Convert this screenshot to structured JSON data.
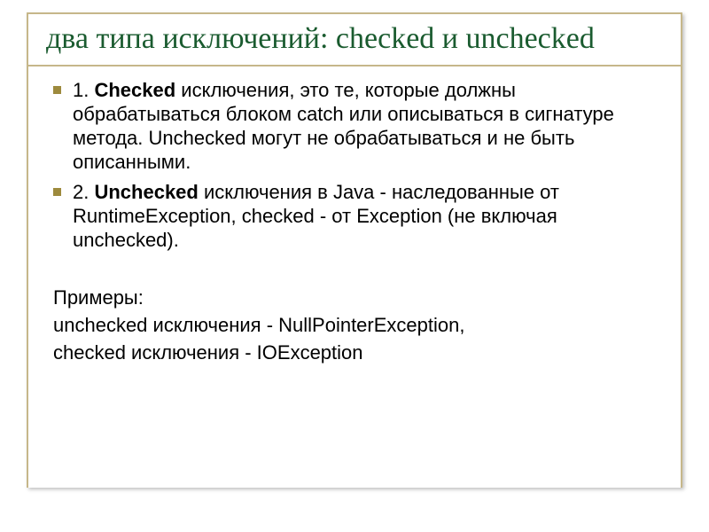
{
  "title": "два типа исключений: checked и unchecked",
  "bullets": [
    {
      "prefix": "1. ",
      "bold": "Checked",
      "rest": " исключения, это те, которые должны обрабатываться блоком catch или описываться в сигнатуре метода. Unchecked могут не обрабатываться и не быть описанными."
    },
    {
      "prefix": "2. ",
      "bold": "Unchecked",
      "rest": " исключения в Java - наследованные от RuntimeException, checked - от Exception (не включая unchecked)."
    }
  ],
  "plain": {
    "heading": "Примеры:",
    "line1": " unchecked исключения - NullPointerException,",
    "line2": "checked исключения - IOException"
  }
}
